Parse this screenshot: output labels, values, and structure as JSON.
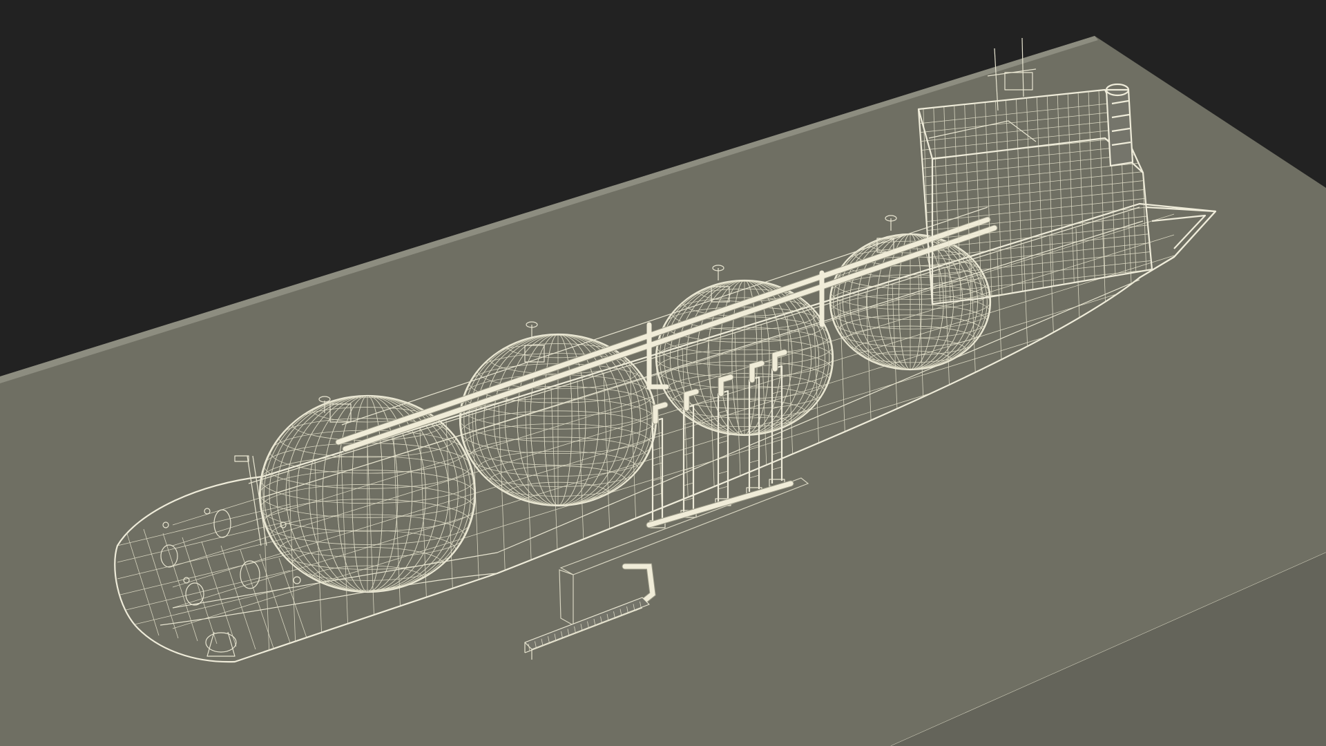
{
  "scene": {
    "subject": "",
    "colors": {
      "background": "#222222",
      "ground": "#6f6f63",
      "ground_edge": "#5c5c52",
      "wireframe": "#e9e6d2"
    }
  }
}
